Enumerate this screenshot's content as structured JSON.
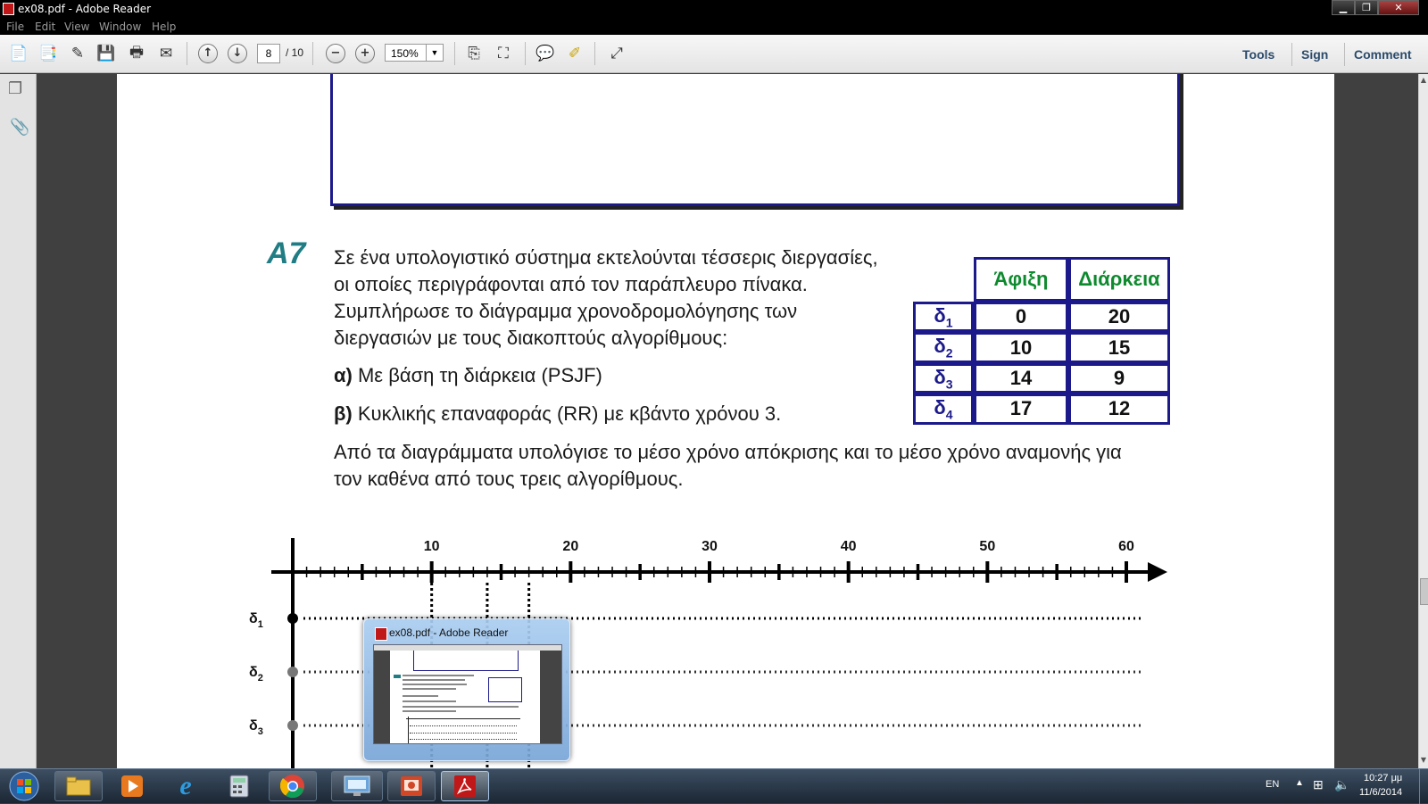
{
  "window": {
    "title": "ex08.pdf - Adobe Reader",
    "controls": [
      "minimize",
      "restore",
      "close"
    ]
  },
  "menu": [
    "File",
    "Edit",
    "View",
    "Window",
    "Help"
  ],
  "toolbar": {
    "current_page": "8",
    "total_pages": "/ 10",
    "zoom": "150%",
    "panels": [
      "Tools",
      "Sign",
      "Comment"
    ]
  },
  "document": {
    "exercise_label": "A7",
    "paragraph_lines": [
      "Σε ένα υπολογιστικό σύστημα εκτελούνται τέσσερις διεργασίες,",
      "οι οποίες περιγράφονται από τον παράπλευρο πίνακα.",
      "Συμπλήρωσε το διάγραμμα χρονοδρομολόγησης των",
      "διεργασιών με τους διακοπτούς αλγορίθμους:"
    ],
    "option_a": {
      "prefix": "α)",
      "text": " Με βάση τη διάρκεια (PSJF)"
    },
    "option_b": {
      "prefix": "β)",
      "text": " Κυκλικής επαναφοράς (RR) με κβάντο χρόνου 3."
    },
    "closing_lines": [
      "Από τα διαγράμματα υπολόγισε το μέσο χρόνο απόκρισης και το μέσο χρόνο αναμονής για",
      "τον καθένα από τους τρεις αλγορίθμους."
    ],
    "table": {
      "headers": [
        "Άφιξη",
        "Διάρκεια"
      ],
      "rows": [
        {
          "label": "δ",
          "sub": "1",
          "arrival": "0",
          "duration": "20"
        },
        {
          "label": "δ",
          "sub": "2",
          "arrival": "10",
          "duration": "15"
        },
        {
          "label": "δ",
          "sub": "3",
          "arrival": "14",
          "duration": "9"
        },
        {
          "label": "δ",
          "sub": "4",
          "arrival": "17",
          "duration": "12"
        }
      ]
    },
    "timeline": {
      "tick_labels": [
        "10",
        "20",
        "30",
        "40",
        "50",
        "60"
      ],
      "max": 60,
      "guides_at": [
        10,
        14,
        17
      ],
      "processes": [
        {
          "label": "δ",
          "sub": "1"
        },
        {
          "label": "δ",
          "sub": "2"
        },
        {
          "label": "δ",
          "sub": "3"
        }
      ]
    }
  },
  "thumbnail": {
    "title": "ex08.pdf - Adobe Reader"
  },
  "taskbar": {
    "apps": [
      "start-button",
      "file-explorer",
      "media-player",
      "internet-explorer",
      "calculator",
      "chrome",
      "remote-desktop",
      "powerpoint",
      "adobe-reader"
    ],
    "language": "EN",
    "time": "10:27 μμ",
    "date": "11/6/2014"
  },
  "colors": {
    "accent_teal": "#1f7d83",
    "table_border": "#1c1a8a",
    "table_header": "#0e8a2e",
    "panel_link": "#2b4a6b"
  }
}
